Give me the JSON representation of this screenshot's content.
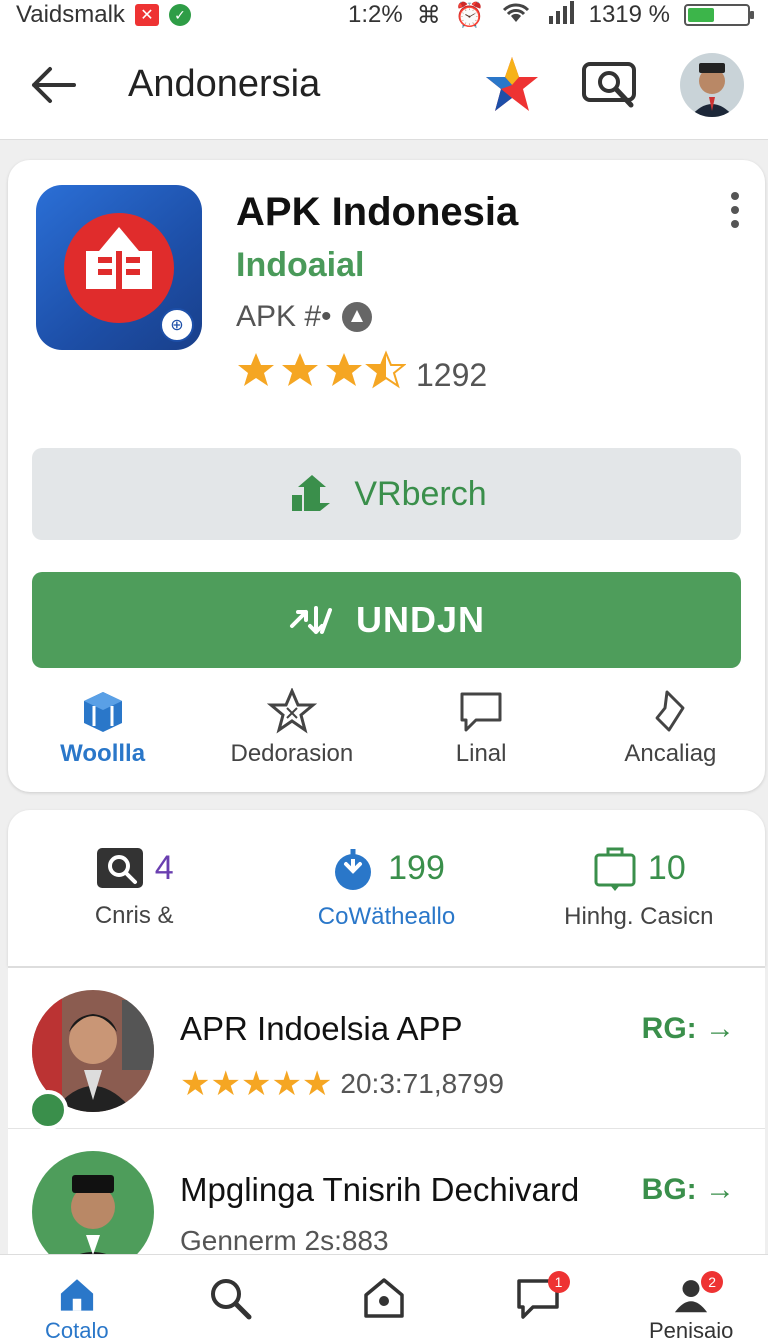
{
  "status_bar": {
    "carrier": "Vaidsmalk",
    "signal_text": "1:2%",
    "time": "1319 %",
    "battery_level": 0.45
  },
  "app_bar": {
    "title": "Andonersia"
  },
  "app": {
    "name": "APK Indonesia",
    "developer": "Indoaial",
    "meta": "APK #•",
    "rating_stars": 3.5,
    "rating_count": "1292"
  },
  "buttons": {
    "version_label": "VRberch",
    "download_label": "UNDJN"
  },
  "quick_actions": [
    {
      "label": "Woollla",
      "active": true
    },
    {
      "label": "Dedorasion",
      "active": false
    },
    {
      "label": "Linal",
      "active": false
    },
    {
      "label": "Ancaliag",
      "active": false
    }
  ],
  "stats": [
    {
      "value": "4",
      "label": "Cnris &",
      "color": "#6a3fb0"
    },
    {
      "value": "199",
      "label": "CoWätheallo",
      "color": "#3a8f4b"
    },
    {
      "value": "10",
      "label": "Hinhg. Casicn",
      "color": "#3a8f4b"
    }
  ],
  "list": [
    {
      "title": "APR Indoelsia APP",
      "stars": "★★★★★",
      "sub": "20:3:71,8799",
      "action": "RG: →"
    },
    {
      "title": "Mpglinga Tnisrih Dechivard",
      "stars": "",
      "sub": "Gennerm 2s:883",
      "action": "BG: →"
    }
  ],
  "bottom_nav": [
    {
      "label": "Cotalo",
      "icon": "home-icon",
      "active": true,
      "badge": ""
    },
    {
      "label": "",
      "icon": "search-icon",
      "active": false,
      "badge": ""
    },
    {
      "label": "",
      "icon": "apps-icon",
      "active": false,
      "badge": ""
    },
    {
      "label": "",
      "icon": "chat-icon",
      "active": false,
      "badge": "1"
    },
    {
      "label": "Penisaio",
      "icon": "profile-icon",
      "active": false,
      "badge": "2"
    }
  ],
  "colors": {
    "accent_green": "#4e9d5b",
    "accent_blue": "#2a77c9",
    "star": "#f5a623"
  }
}
